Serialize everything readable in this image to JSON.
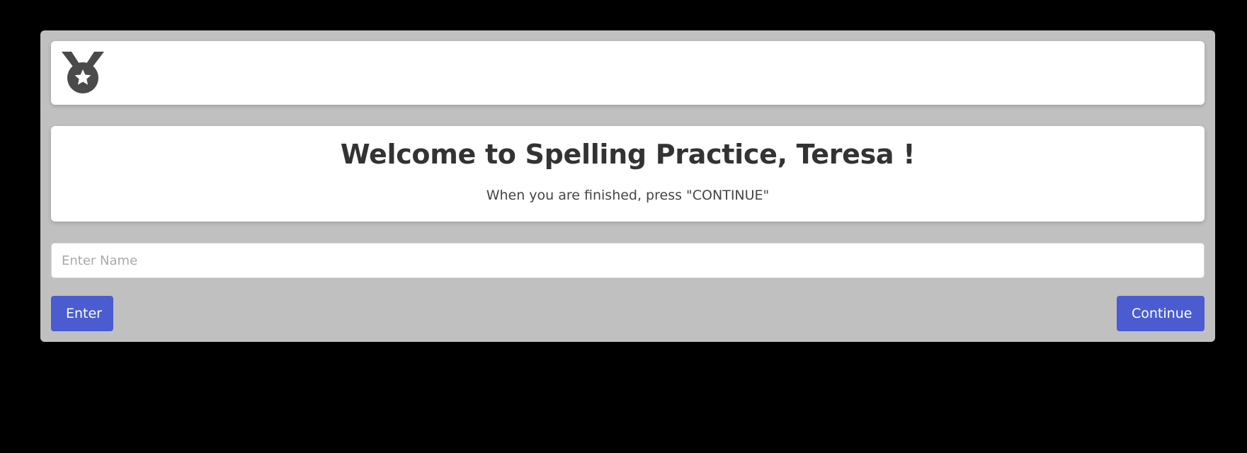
{
  "header": {
    "logo_icon": "medal-star-icon",
    "logo_color": "#4a4a4a"
  },
  "welcome": {
    "title": "Welcome to Spelling Practice, Teresa !",
    "subtitle": "When you are finished, press \"CONTINUE\""
  },
  "form": {
    "name_placeholder": "Enter Name",
    "name_value": ""
  },
  "buttons": {
    "enter_label": "Enter",
    "continue_label": "Continue"
  },
  "colors": {
    "accent": "#4a5ccf",
    "panel_background": "#c0c0c0",
    "page_background": "#000000"
  }
}
